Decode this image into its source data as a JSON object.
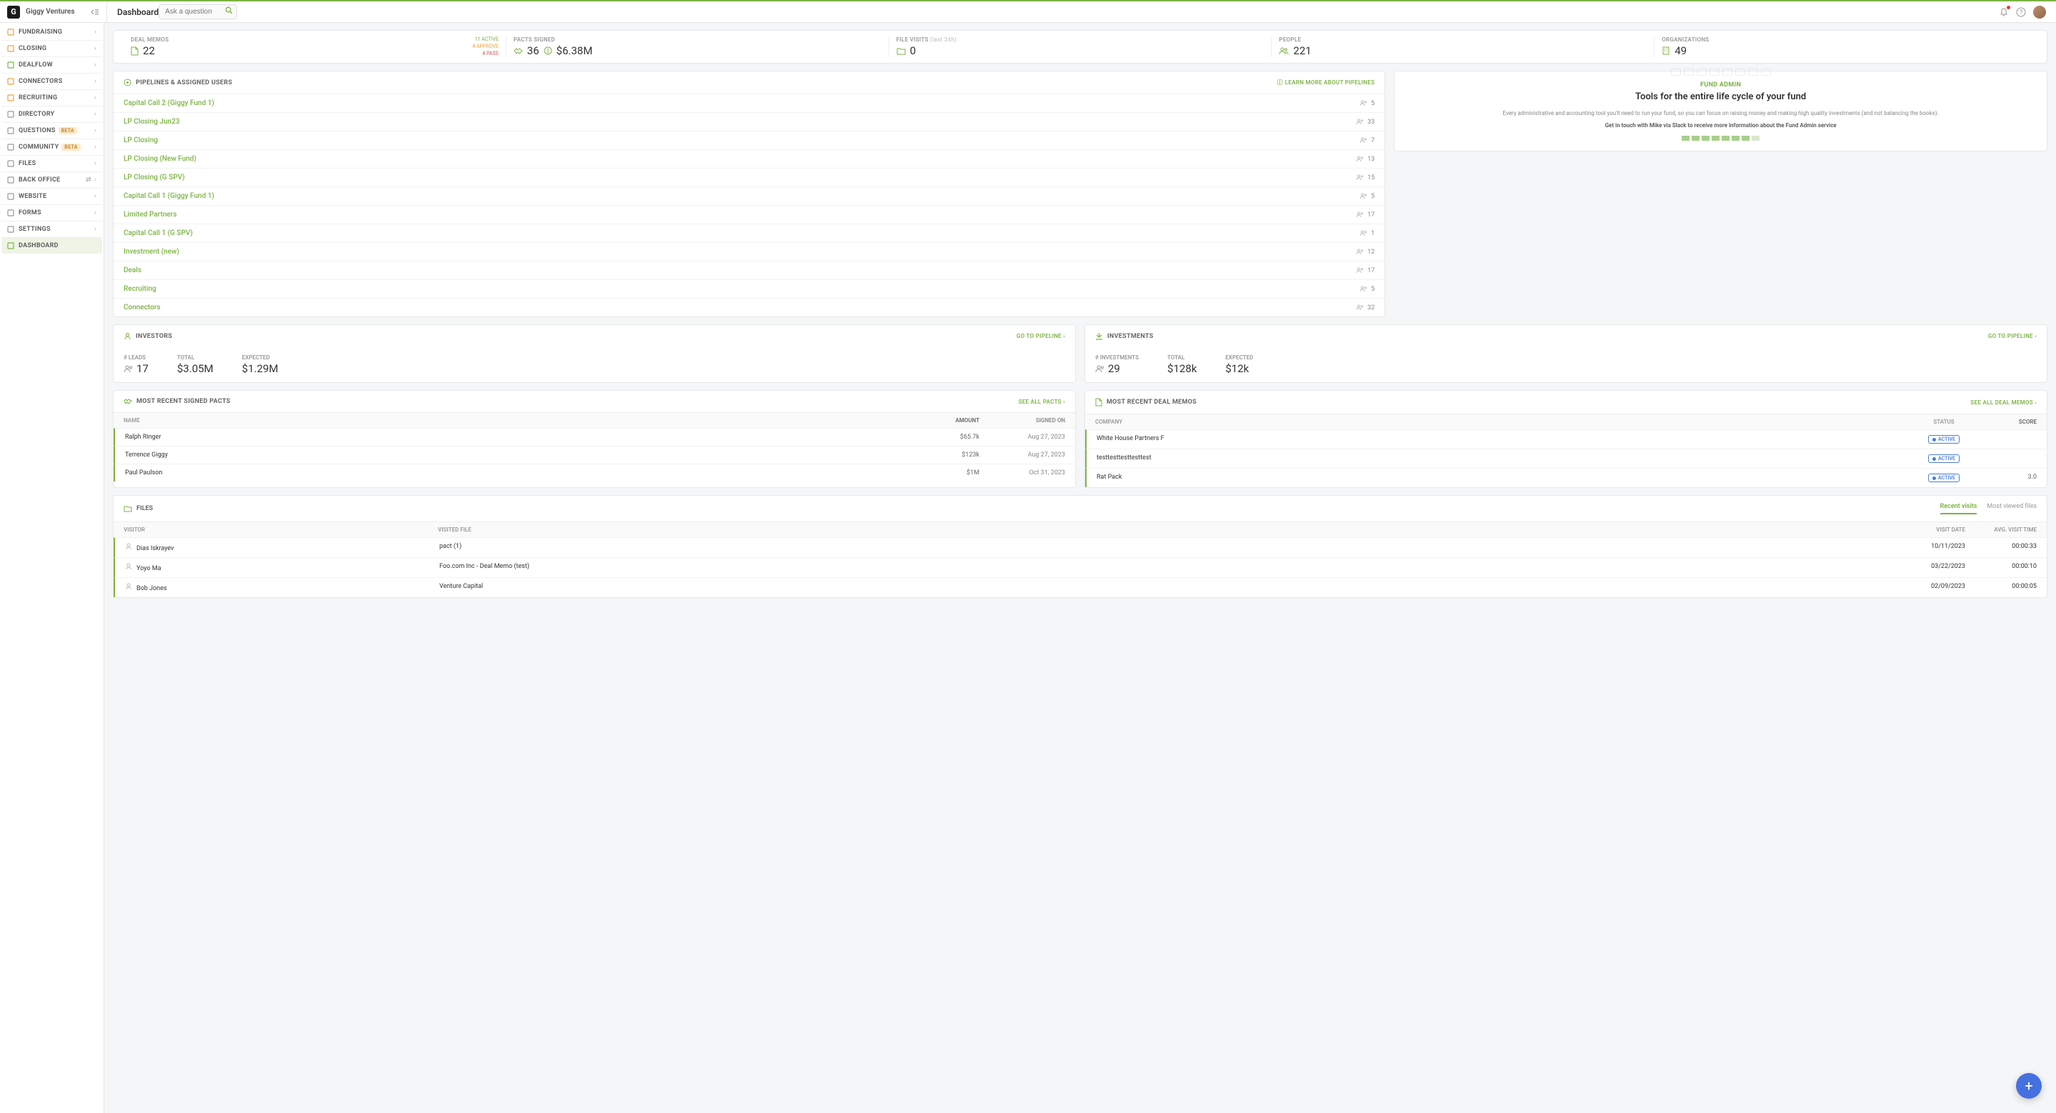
{
  "header": {
    "org_name": "Giggy Ventures",
    "page_title": "Dashboard",
    "search_placeholder": "Ask a question"
  },
  "sidebar": {
    "items": [
      {
        "label": "FUNDRAISING",
        "icon_color": "#e8a33d"
      },
      {
        "label": "CLOSING",
        "icon_color": "#e8a33d"
      },
      {
        "label": "DEALFLOW",
        "icon_color": "#7cb342"
      },
      {
        "label": "CONNECTORS",
        "icon_color": "#e8a33d"
      },
      {
        "label": "RECRUITING",
        "icon_color": "#e8a33d"
      },
      {
        "label": "DIRECTORY",
        "icon_color": "#999"
      },
      {
        "label": "QUESTIONS",
        "beta": "BETA",
        "icon_color": "#999"
      },
      {
        "label": "COMMUNITY",
        "beta": "BETA",
        "icon_color": "#999"
      },
      {
        "label": "FILES",
        "icon_color": "#999"
      },
      {
        "label": "BACK OFFICE",
        "icon_color": "#999",
        "sync": true
      },
      {
        "label": "WEBSITE",
        "icon_color": "#999"
      },
      {
        "label": "FORMS",
        "icon_color": "#999"
      },
      {
        "label": "SETTINGS",
        "icon_color": "#999"
      },
      {
        "label": "DASHBOARD",
        "icon_color": "#7cb342",
        "active": true
      }
    ]
  },
  "stats": {
    "deal_memos": {
      "label": "DEAL MEMOS",
      "value": "22",
      "side": {
        "active": "11 ACTIVE",
        "approve": "4 APPROVE",
        "pass": "4 PASS"
      }
    },
    "pacts": {
      "label": "PACTS SIGNED",
      "count": "36",
      "amount": "$6.38M"
    },
    "file_visits": {
      "label": "FILE VISITS",
      "suffix": "(last 24h)",
      "value": "0"
    },
    "people": {
      "label": "PEOPLE",
      "value": "221"
    },
    "orgs": {
      "label": "ORGANIZATIONS",
      "value": "49"
    }
  },
  "pipelines": {
    "title": "PIPELINES & ASSIGNED USERS",
    "learn_more": "LEARN MORE ABOUT PIPELINES",
    "rows": [
      {
        "name": "Capital Call 2 (Giggy Fund 1)",
        "count": "5"
      },
      {
        "name": "LP Closing Jun23",
        "count": "33"
      },
      {
        "name": "LP Closing",
        "count": "7"
      },
      {
        "name": "LP Closing (New Fund)",
        "count": "13"
      },
      {
        "name": "LP Closing (G SPV)",
        "count": "15"
      },
      {
        "name": "Capital Call 1 (Giggy Fund 1)",
        "count": "5"
      },
      {
        "name": "Limited Partners",
        "count": "17"
      },
      {
        "name": "Capital Call 1 (G SPV)",
        "count": "1"
      },
      {
        "name": "Investment (new)",
        "count": "12"
      },
      {
        "name": "Deals",
        "count": "17"
      },
      {
        "name": "Recruiting",
        "count": "5"
      },
      {
        "name": "Connectors",
        "count": "32"
      }
    ]
  },
  "fund_admin": {
    "title": "FUND ADMIN",
    "heading": "Tools for the entire life cycle of your fund",
    "desc": "Every administrative and accounting tool you'll need to run your fund, so you can focus on raising money and making high quality investments (and not balancing the books).",
    "cta": "Get in touch with Mike via Slack to receive more information about the Fund Admin service"
  },
  "investors": {
    "title": "INVESTORS",
    "link": "GO TO PIPELINE",
    "leads": {
      "label": "# LEADS",
      "value": "17"
    },
    "total": {
      "label": "TOTAL",
      "value": "$3.05M"
    },
    "expected": {
      "label": "EXPECTED",
      "value": "$1.29M"
    }
  },
  "investments": {
    "title": "INVESTMENTS",
    "link": "GO TO PIPELINE",
    "count": {
      "label": "# INVESTMENTS",
      "value": "29"
    },
    "total": {
      "label": "TOTAL",
      "value": "$128k"
    },
    "expected": {
      "label": "EXPECTED",
      "value": "$12k"
    }
  },
  "recent_pacts": {
    "title": "MOST RECENT SIGNED PACTS",
    "link": "SEE ALL PACTS",
    "cols": {
      "name": "NAME",
      "amount": "AMOUNT",
      "date": "SIGNED ON"
    },
    "rows": [
      {
        "name": "Ralph Ringer",
        "amount": "$65.7k",
        "date": "Aug 27, 2023"
      },
      {
        "name": "Terrence Giggy",
        "amount": "$123k",
        "date": "Aug 27, 2023"
      },
      {
        "name": "Paul Paulson",
        "amount": "$1M",
        "date": "Oct 31, 2023"
      }
    ]
  },
  "recent_memos": {
    "title": "MOST RECENT DEAL MEMOS",
    "link": "SEE ALL DEAL MEMOS",
    "cols": {
      "company": "COMPANY",
      "status": "STATUS",
      "score": "SCORE"
    },
    "status_label": "ACTIVE",
    "rows": [
      {
        "company": "White House Partners F",
        "score": ""
      },
      {
        "company": "testtesttesttesttest",
        "score": ""
      },
      {
        "company": "Rat Pack",
        "score": "3.0"
      }
    ]
  },
  "files": {
    "title": "FILES",
    "tabs": {
      "recent": "Recent visits",
      "most": "Most viewed files"
    },
    "cols": {
      "visitor": "VISITOR",
      "file": "VISITED FILE",
      "date": "VISIT DATE",
      "time": "AVG. VISIT TIME"
    },
    "rows": [
      {
        "visitor": "Dias Iskrayev",
        "file": "pact (1)",
        "date": "10/11/2023",
        "time": "00:00:33"
      },
      {
        "visitor": "Yoyo Ma",
        "file": "Foo.com Inc - Deal Memo (test)",
        "date": "03/22/2023",
        "time": "00:00:10"
      },
      {
        "visitor": "Bob Jones",
        "file": "Venture Capital",
        "date": "02/09/2023",
        "time": "00:00:05"
      }
    ]
  }
}
